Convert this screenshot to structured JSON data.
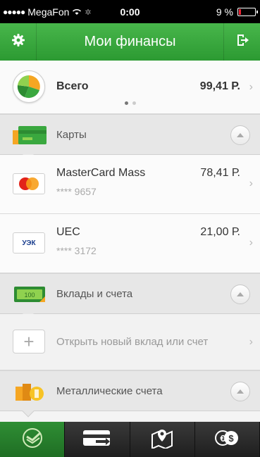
{
  "status": {
    "carrier": "MegaFon",
    "time": "0:00",
    "battery": "9 %"
  },
  "header": {
    "title": "Мои финансы",
    "settings_icon": "gear-icon",
    "logout_icon": "logout-icon"
  },
  "total": {
    "label": "Всего",
    "amount": "99,41 Р.",
    "pages": 2,
    "active_page": 1
  },
  "sections": {
    "cards": {
      "label": "Карты",
      "items": [
        {
          "name": "MasterCard Mass",
          "number": "**** 9657",
          "amount": "78,41 Р.",
          "logo": "MasterCard"
        },
        {
          "name": "UEC",
          "number": "**** 3172",
          "amount": "21,00 Р.",
          "logo": "УЭК"
        }
      ]
    },
    "deposits": {
      "label": "Вклады и счета",
      "open_label": "Открыть новый вклад или счет"
    },
    "metals": {
      "label": "Металлические счета"
    }
  },
  "tabs": [
    "home-icon",
    "transfer-icon",
    "map-pin-icon",
    "currency-icon"
  ],
  "colors": {
    "brand_green": "#3aa83f",
    "mastercard_red": "#e2231a",
    "mastercard_orange": "#f79e1b"
  }
}
